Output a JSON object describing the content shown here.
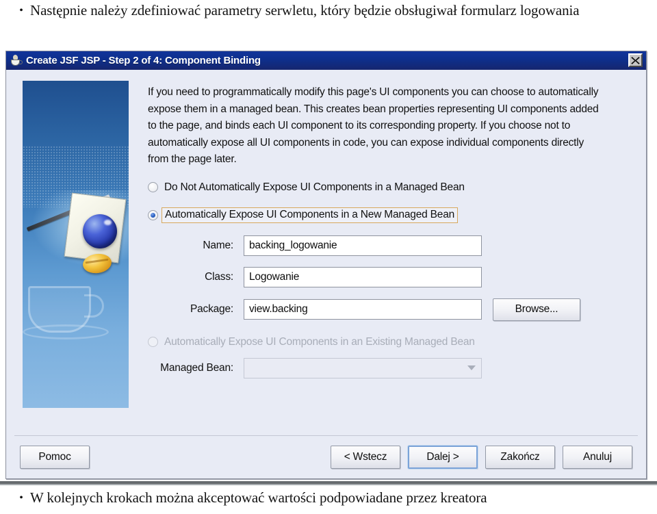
{
  "slide": {
    "bullet_glyph": "•",
    "top_text": "Następnie należy zdefiniować parametry serwletu, który będzie obsługiwał formularz logowania",
    "bottom_text": "W kolejnych krokach można akceptować wartości podpowiadane przez kreatora"
  },
  "dialog": {
    "title": "Create JSF JSP - Step 2 of 4: Component Binding",
    "title_icon": "java-coffee-cup-icon",
    "close_icon": "close-icon",
    "description": "If you need to programmatically modify this page's UI components you can choose to automatically expose them in a managed bean. This creates bean properties representing UI components added to the page, and binds each UI component to its corresponding property. If you choose not to automatically expose all UI components in code, you can expose individual components directly from the page later.",
    "radios": [
      {
        "id": "do-not-expose",
        "label": "Do Not Automatically Expose UI Components in a Managed Bean",
        "checked": false,
        "disabled": false,
        "focused": false
      },
      {
        "id": "expose-new-bean",
        "label": "Automatically Expose UI Components in a New Managed Bean",
        "checked": true,
        "disabled": false,
        "focused": true
      },
      {
        "id": "expose-existing-bean",
        "label": "Automatically Expose UI Components in an Existing Managed Bean",
        "checked": false,
        "disabled": true,
        "focused": false
      }
    ],
    "fields": {
      "name": {
        "label": "Name:",
        "value": "backing_logowanie",
        "placeholder": ""
      },
      "class": {
        "label": "Class:",
        "value": "Logowanie",
        "placeholder": ""
      },
      "package": {
        "label": "Package:",
        "value": "view.backing",
        "placeholder": ""
      },
      "managed_bean": {
        "label": "Managed Bean:",
        "value": "",
        "placeholder": ""
      }
    },
    "browse_button": "Browse...",
    "footer_buttons": {
      "help": "Pomoc",
      "back": "< Wstecz",
      "next": "Dalej >",
      "finish": "Zakończ",
      "cancel": "Anuluj"
    }
  },
  "colors": {
    "titlebar": "#11359b",
    "dialog_bg": "#e8ebf5",
    "focus_outline": "#d7a85c",
    "default_button_ring": "#7ba3d8",
    "radio_dot": "#2b62c4",
    "banner_top": "#1f4f8f",
    "banner_bottom": "#8dbbe4"
  }
}
